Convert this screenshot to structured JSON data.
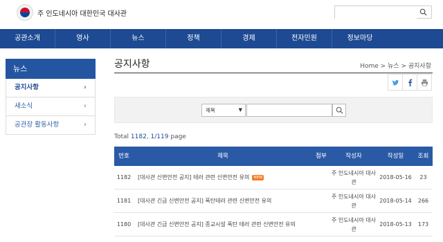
{
  "header": {
    "site_name": "주 인도네시아 대한민국 대사관",
    "search_placeholder": ""
  },
  "nav": [
    "공관소개",
    "영사",
    "뉴스",
    "정책",
    "경제",
    "전자민원",
    "정보마당"
  ],
  "sidebar": {
    "title": "뉴스",
    "items": [
      {
        "label": "공지사항",
        "active": true
      },
      {
        "label": "새소식",
        "active": false
      },
      {
        "label": "공관장 활동사항",
        "active": false
      }
    ]
  },
  "page": {
    "title": "공지사항",
    "breadcrumb": "Home > 뉴스 > 공지사항"
  },
  "search": {
    "select_value": "제목",
    "input_value": ""
  },
  "total": {
    "prefix": "Total",
    "count": "1182",
    "pages": "1/119",
    "suffix": "page"
  },
  "table": {
    "headers": {
      "no": "번호",
      "title": "제목",
      "attach": "첨부",
      "author": "작성자",
      "date": "작성일",
      "views": "조회"
    },
    "rows": [
      {
        "no": "1182",
        "title": "[대사관 신변안전 공지] 테러 관련 신변안전 유의",
        "new": "NEW",
        "author": "주 인도네시아 대사관",
        "date": "2018-05-16",
        "views": "23"
      },
      {
        "no": "1181",
        "title": "[대사관 긴급 신변안전 공지] 폭탄테러 관련 신변안전 유의",
        "new": "",
        "author": "주 인도네시아 대사관",
        "date": "2018-05-14",
        "views": "266"
      },
      {
        "no": "1180",
        "title": "[대사관 긴급 신변안전 공지] 종교시설 폭탄 테러 관련 신변안전 유의",
        "new": "",
        "author": "주 인도네시아 대사관",
        "date": "2018-05-13",
        "views": "173"
      }
    ]
  },
  "colors": {
    "nav_bg": "#1d4a92",
    "accent": "#2455a1",
    "new_badge": "#f47b20"
  }
}
